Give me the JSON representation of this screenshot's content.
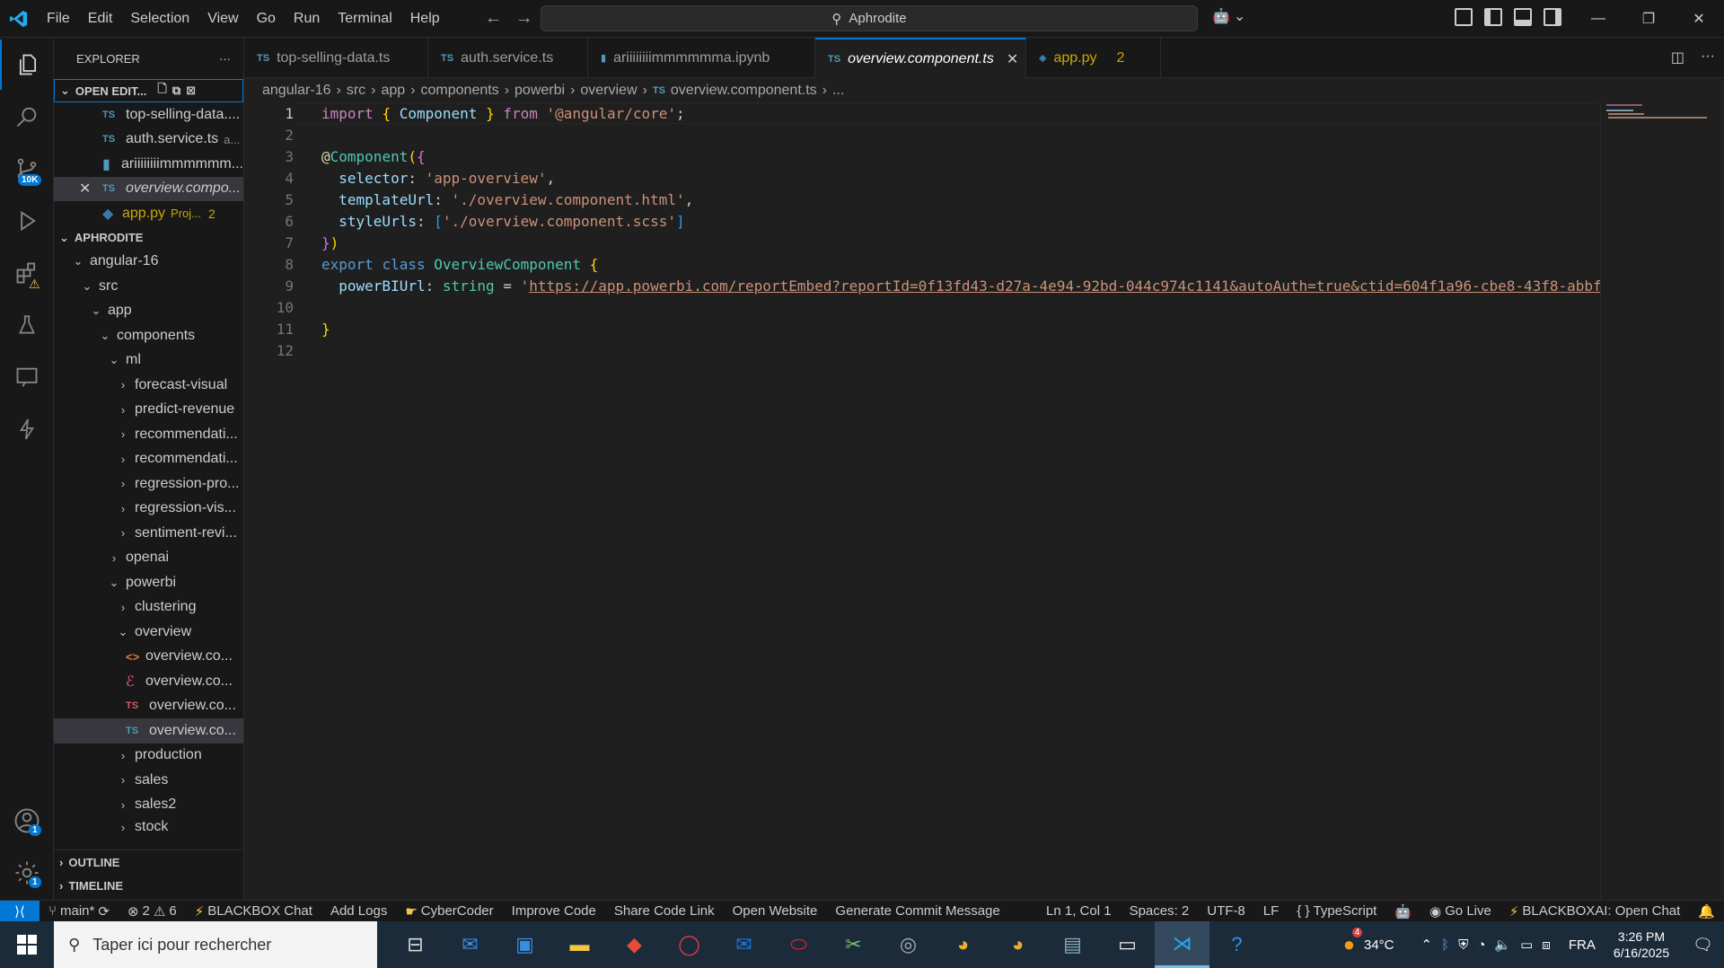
{
  "titlebar": {
    "menu": [
      "File",
      "Edit",
      "Selection",
      "View",
      "Go",
      "Run",
      "Terminal",
      "Help"
    ],
    "search_text": "Aphrodite"
  },
  "activity": {
    "source_control_badge": "10K",
    "accounts_badge": "1",
    "settings_badge": "1"
  },
  "sidebar": {
    "title": "EXPLORER",
    "open_editors_label": "OPEN EDIT...",
    "open_editors": [
      {
        "name": "top-selling-data....",
        "icon": "TS"
      },
      {
        "name": "auth.service.ts",
        "icon": "TS",
        "desc": "a..."
      },
      {
        "name": "ariiiiiiiimmmmmm...",
        "icon": "notebook"
      },
      {
        "name": "overview.compo...",
        "icon": "TS"
      },
      {
        "name": "app.py",
        "icon": "python",
        "desc": "Proj...",
        "errors": "2"
      }
    ],
    "workspace_label": "APHRODITE",
    "tree": [
      "angular-16",
      "src",
      "app",
      "components",
      "ml",
      "forecast-visual",
      "predict-revenue",
      "recommendati...",
      "recommendati...",
      "regression-pro...",
      "regression-vis...",
      "sentiment-revi...",
      "openai",
      "powerbi",
      "clustering",
      "overview",
      "overview.co...",
      "overview.co...",
      "overview.co...",
      "overview.co...",
      "production",
      "sales",
      "sales2",
      "stock"
    ],
    "outline_label": "OUTLINE",
    "timeline_label": "TIMELINE"
  },
  "tabs": [
    {
      "label": "top-selling-data.ts",
      "icon": "TS"
    },
    {
      "label": "auth.service.ts",
      "icon": "TS"
    },
    {
      "label": "ariiiiiiiimmmmmma.ipynb",
      "icon": "notebook"
    },
    {
      "label": "overview.component.ts",
      "icon": "TS",
      "active": true
    },
    {
      "label": "app.py",
      "icon": "python",
      "count": "2"
    }
  ],
  "breadcrumb": [
    "angular-16",
    "src",
    "app",
    "components",
    "powerbi",
    "overview",
    "overview.component.ts",
    "..."
  ],
  "editor": {
    "line_numbers": [
      "1",
      "2",
      "3",
      "4",
      "5",
      "6",
      "7",
      "8",
      "9",
      "10",
      "11",
      "12"
    ],
    "code": {
      "l1_import": "import",
      "l1_ob": "{",
      "l1_component": "Component",
      "l1_cb": "}",
      "l1_from": "from",
      "l1_module": "'@angular/core'",
      "l1_semi": ";",
      "l3_at": "@",
      "l3_dec": "Component",
      "l3_paren": "(",
      "l3_brace": "{",
      "l4_key": "selector",
      "l4_val": "'app-overview'",
      "l5_key": "templateUrl",
      "l5_val": "'./overview.component.html'",
      "l6_key": "styleUrls",
      "l6_ob": "[",
      "l6_val": "'./overview.component.scss'",
      "l6_cb": "]",
      "l7_brace": "}",
      "l7_paren": ")",
      "l8_export": "export",
      "l8_class": "class",
      "l8_name": "OverviewComponent",
      "l8_brace": "{",
      "l9_key": "powerBIUrl",
      "l9_type": "string",
      "l9_quote": "'",
      "l9_url": "https://app.powerbi.com/reportEmbed?reportId=0f13fd43-d27a-4e94-92bd-044c974c1141&autoAuth=true&ctid=604f1a96-cbe8-43f8-abbf",
      "l11_brace": "}"
    }
  },
  "statusbar": {
    "branch": "main*",
    "errors": "2",
    "warnings": "6",
    "items_left": [
      "BLACKBOX Chat",
      "Add Logs",
      "CyberCoder",
      "Improve Code",
      "Share Code Link",
      "Open Website",
      "Generate Commit Message"
    ],
    "position": "Ln 1, Col 1",
    "spaces": "Spaces: 2",
    "encoding": "UTF-8",
    "eol": "LF",
    "language": "TypeScript",
    "golive": "Go Live",
    "blackbox_open": "BLACKBOXAI: Open Chat"
  },
  "taskbar": {
    "search_placeholder": "Taper ici pour rechercher",
    "weather": "34°C",
    "weather_badge": "4",
    "lang": "FRA",
    "time": "3:26 PM",
    "date": "6/16/2025"
  },
  "colors": {
    "accent": "#0078d4",
    "keyword": "#c586c0",
    "string": "#ce9178",
    "warning": "#cca700"
  }
}
